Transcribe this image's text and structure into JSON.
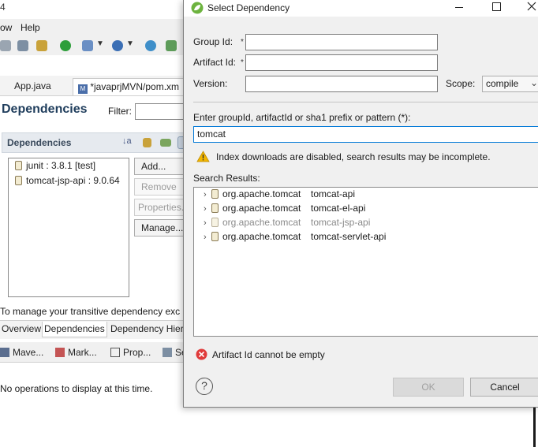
{
  "eclipse": {
    "title_fragment": "4",
    "menu": [
      "ow",
      "Help"
    ],
    "editor_tabs": [
      "App.java",
      "*javaprjMVN/pom.xm"
    ],
    "page_title": "Dependencies",
    "filter_label": "Filter:",
    "section_title": "Dependencies",
    "dependencies": [
      "junit : 3.8.1 [test]",
      "tomcat-jsp-api : 9.0.64"
    ],
    "side_buttons": [
      "Add...",
      "Remove",
      "Properties...",
      "Manage..."
    ],
    "transitive_text": "To manage your transitive dependency exc",
    "bottom_tabs": [
      "Overview",
      "Dependencies",
      "Dependency Hier"
    ],
    "views": [
      "Mave...",
      "Mark...",
      "Prop...",
      "Se"
    ],
    "no_ops": "No operations to display at this time."
  },
  "dialog": {
    "title": "Select Dependency",
    "group_id_label": "Group Id:",
    "artifact_id_label": "Artifact Id:",
    "version_label": "Version:",
    "required_mark": "*",
    "group_id_value": "",
    "artifact_id_value": "",
    "version_value": "",
    "scope_label": "Scope:",
    "scope_value": "compile",
    "search_label": "Enter groupId, artifactId or sha1 prefix or pattern (*):",
    "search_value": "tomcat",
    "warning_text": "Index downloads are disabled, search results may be incomplete.",
    "results_label": "Search Results:",
    "results": [
      {
        "group": "org.apache.tomcat",
        "artifact": "tomcat-api",
        "dimmed": false
      },
      {
        "group": "org.apache.tomcat",
        "artifact": "tomcat-el-api",
        "dimmed": false
      },
      {
        "group": "org.apache.tomcat",
        "artifact": "tomcat-jsp-api",
        "dimmed": true
      },
      {
        "group": "org.apache.tomcat",
        "artifact": "tomcat-servlet-api",
        "dimmed": false
      }
    ],
    "error_text": "Artifact Id cannot be empty",
    "ok_label": "OK",
    "cancel_label": "Cancel",
    "help_symbol": "?"
  },
  "colors": {
    "accent": "#0078d7",
    "error": "#e03b3b",
    "warning": "#f2b600",
    "spring_green": "#6db33f"
  },
  "icons": [
    "spring-icon",
    "minimize-icon",
    "maximize-icon",
    "close-icon",
    "warning-icon",
    "error-icon",
    "help-icon",
    "jar-icon",
    "chevron-right-icon"
  ]
}
